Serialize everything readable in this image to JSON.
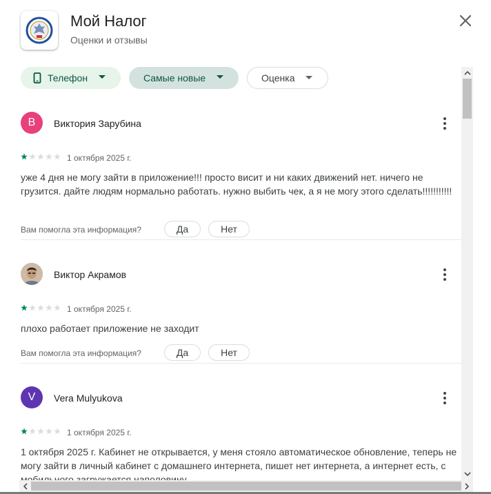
{
  "app": {
    "title": "Мой Налог",
    "subtitle": "Оценки и отзывы",
    "icon": "fns-emblem-icon"
  },
  "filters": {
    "device_label": "Телефон",
    "sort_label": "Самые новые",
    "rating_label": "Оценка"
  },
  "colors": {
    "accent_green": "#0b5740",
    "star_filled": "#01875f",
    "star_empty": "#dadce0"
  },
  "reviews": [
    {
      "name": "Виктория Зарубина",
      "avatar_letter": "В",
      "avatar_color": "#e8407b",
      "rating": 1,
      "date": "1 октября 2025 г.",
      "text": "уже 4 дня не могу зайти в приложение!!! просто висит и ни каких движений нет. ничего не грузится. дайте людям нормально работать. нужно выбить чек, а я не могу этого сделать!!!!!!!!!!!",
      "helpful_question": "Вам помогла эта информация?",
      "yes_label": "Да",
      "no_label": "Нет"
    },
    {
      "name": "Виктор Акрамов",
      "avatar_letter": "",
      "avatar_color": "#8d6e63",
      "rating": 1,
      "date": "1 октября 2025 г.",
      "text": "плохо работает приложение не заходит",
      "helpful_question": "Вам помогла эта информация?",
      "yes_label": "Да",
      "no_label": "Нет"
    },
    {
      "name": "Vera Mulyukova",
      "avatar_letter": "V",
      "avatar_color": "#5e35b1",
      "rating": 1,
      "date": "1 октября 2025 г.",
      "text": "1 октября 2025 г. Кабинет не открывается, у меня стояло автоматическое обновление, теперь не могу зайти в личный кабинет с домашнего интернета, пишет нет интернета, а интернет есть, с мобильного загружается наполовину"
    }
  ]
}
